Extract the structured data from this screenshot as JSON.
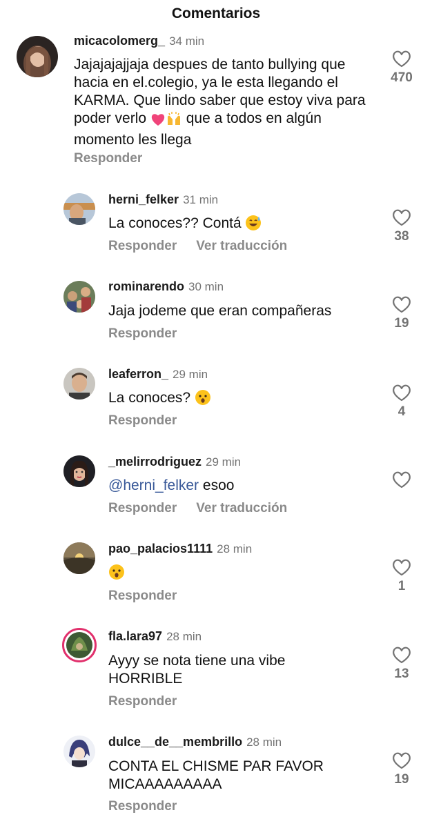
{
  "header": {
    "title": "Comentarios"
  },
  "labels": {
    "reply": "Responder",
    "translate": "Ver traducción"
  },
  "comments": [
    {
      "username": "micacolomerg_",
      "time": "34 min",
      "text_part1": "Jajajajajjaja despues de tanto bullying que hacia en el.colegio, ya le esta llegando el KARMA. Que lindo saber que estoy viva para poder verlo",
      "text_part2": "que a todos en algún momento les llega",
      "likes": "470"
    },
    {
      "username": "herni_felker",
      "time": "31 min",
      "text": "La conoces?? Contá",
      "likes": "38"
    },
    {
      "username": "rominarendo",
      "time": "30 min",
      "text": "Jaja jodeme que eran compañeras",
      "likes": "19"
    },
    {
      "username": "leaferron_",
      "time": "29 min",
      "text": "La conoces?",
      "likes": "4"
    },
    {
      "username": "_melirrodriguez",
      "time": "29 min",
      "mention": "@herni_felker",
      "text": "esoo",
      "likes": ""
    },
    {
      "username": "pao_palacios1111",
      "time": "28 min",
      "text": "",
      "likes": "1"
    },
    {
      "username": "fla.lara97",
      "time": "28 min",
      "text": "Ayyy se nota tiene una vibe HORRIBLE",
      "likes": "13"
    },
    {
      "username": "dulce__de__membrillo",
      "time": "28 min",
      "text": "CONTA EL CHISME PAR FAVOR MICAAAAAAAAA",
      "likes": "19"
    }
  ],
  "colors": {
    "mention": "#385898",
    "muted": "#737373",
    "story_ring": "#e1306c"
  },
  "icons": {
    "like": "heart-outline-icon"
  }
}
